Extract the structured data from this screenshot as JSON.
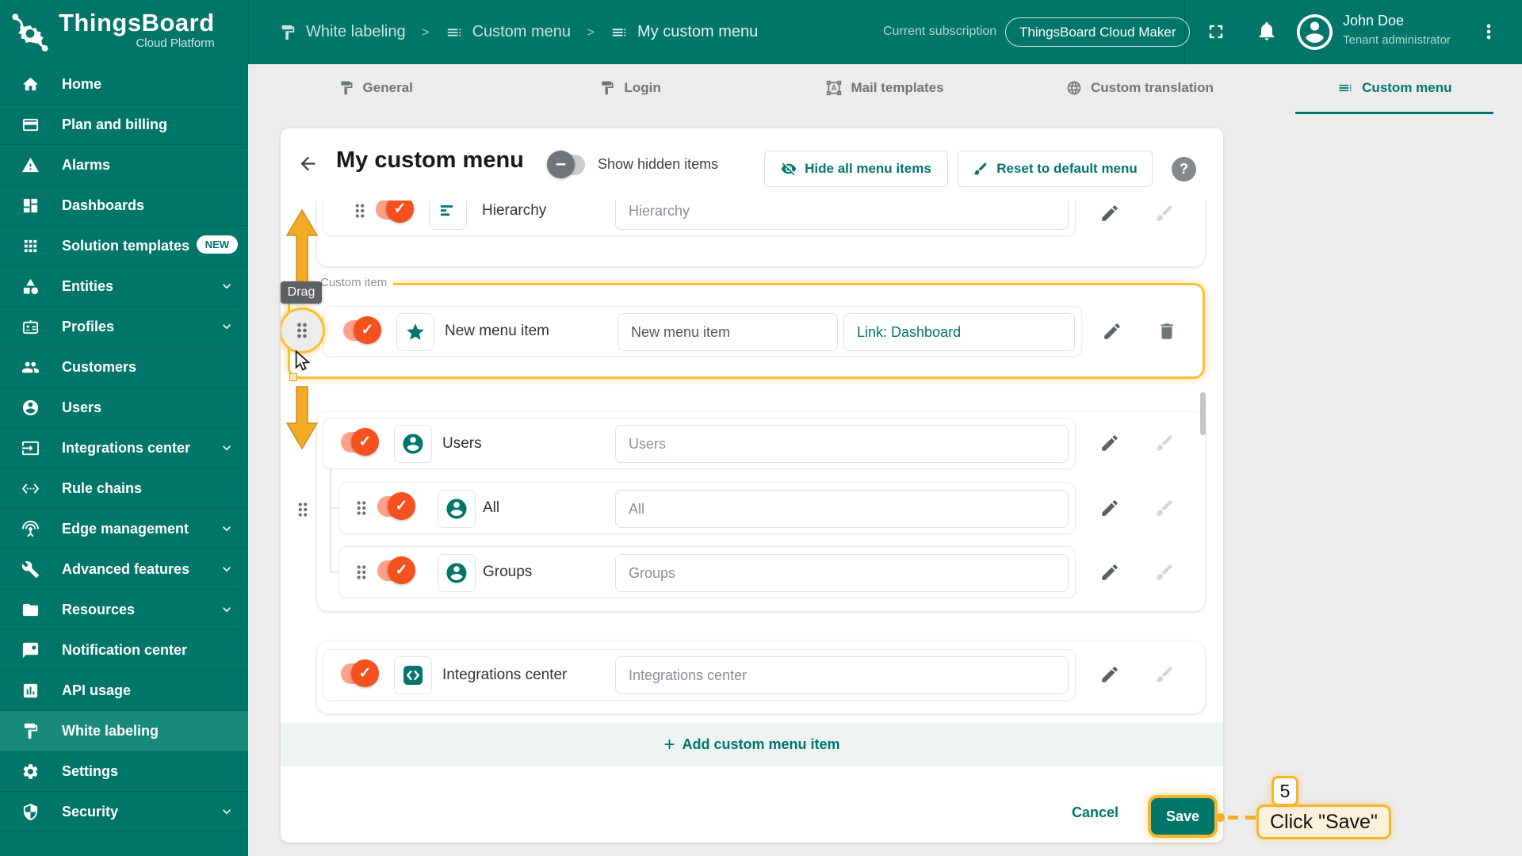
{
  "header": {
    "logo": {
      "title": "ThingsBoard",
      "subtitle": "Cloud Platform"
    },
    "breadcrumb": {
      "separator": ">",
      "items": [
        {
          "label": "White labeling",
          "icon": "paint-roller"
        },
        {
          "label": "Custom menu",
          "icon": "list"
        },
        {
          "label": "My custom menu",
          "icon": "list"
        }
      ]
    },
    "subscription": {
      "label": "Current subscription",
      "plan": "ThingsBoard Cloud Maker"
    },
    "user": {
      "name": "John Doe",
      "role": "Tenant administrator"
    }
  },
  "sidebar": {
    "items": [
      {
        "label": "Home"
      },
      {
        "label": "Plan and billing"
      },
      {
        "label": "Alarms"
      },
      {
        "label": "Dashboards"
      },
      {
        "label": "Solution templates",
        "badge": "NEW"
      },
      {
        "label": "Entities"
      },
      {
        "label": "Profiles"
      },
      {
        "label": "Customers"
      },
      {
        "label": "Users"
      },
      {
        "label": "Integrations center"
      },
      {
        "label": "Rule chains"
      },
      {
        "label": "Edge management"
      },
      {
        "label": "Advanced features"
      },
      {
        "label": "Resources"
      },
      {
        "label": "Notification center"
      },
      {
        "label": "API usage"
      },
      {
        "label": "White labeling"
      },
      {
        "label": "Settings"
      },
      {
        "label": "Security"
      }
    ]
  },
  "tabs": {
    "items": [
      {
        "label": "General"
      },
      {
        "label": "Login"
      },
      {
        "label": "Mail templates"
      },
      {
        "label": "Custom translation"
      },
      {
        "label": "Custom menu"
      }
    ]
  },
  "panel": {
    "title": "My custom menu",
    "show_hidden": "Show hidden items",
    "hide_all": "Hide all menu items",
    "reset": "Reset to default menu",
    "help": "?"
  },
  "menu": {
    "hierarchy": {
      "label": "Hierarchy",
      "value": "Hierarchy"
    },
    "custom_item": {
      "legend": "Custom item",
      "drag_tooltip": "Drag",
      "label": "New menu item",
      "value": "New menu item",
      "link": "Link: Dashboard"
    },
    "users": {
      "label": "Users",
      "value": "Users"
    },
    "users_children": [
      {
        "label": "All",
        "value": "All"
      },
      {
        "label": "Groups",
        "value": "Groups"
      }
    ],
    "integrations": {
      "label": "Integrations center",
      "value": "Integrations center"
    },
    "add_item": "Add custom menu item"
  },
  "footer": {
    "cancel": "Cancel",
    "save": "Save"
  },
  "annotations": {
    "step_number": "5",
    "step_text": "Click \"Save\""
  },
  "colors": {
    "teal": "#00756a",
    "toggle_orange": "#f4511e",
    "highlight_amber": "#f5b62c"
  }
}
